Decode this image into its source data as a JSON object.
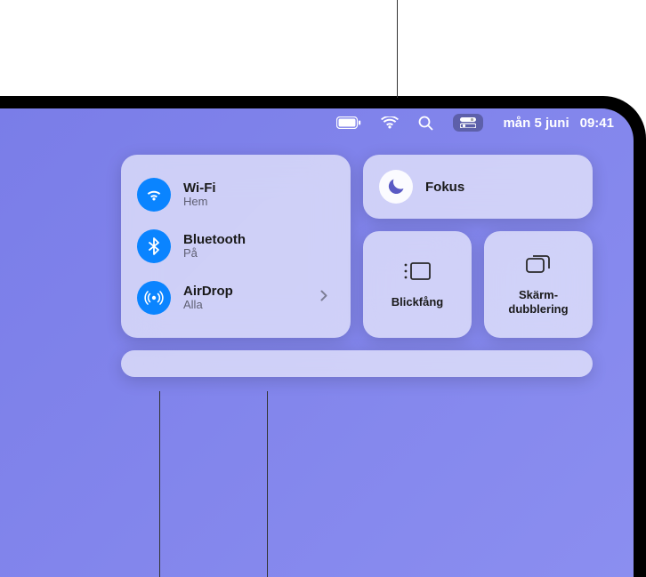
{
  "menubar": {
    "date": "mån 5 juni",
    "time": "09:41"
  },
  "controlcenter": {
    "connectivity": {
      "wifi": {
        "title": "Wi-Fi",
        "status": "Hem"
      },
      "bluetooth": {
        "title": "Bluetooth",
        "status": "På"
      },
      "airdrop": {
        "title": "AirDrop",
        "status": "Alla"
      }
    },
    "focus": {
      "label": "Fokus"
    },
    "stagemanager": {
      "label": "Blickfång"
    },
    "screenmirroring": {
      "label": "Skärm-\ndubblering"
    }
  }
}
